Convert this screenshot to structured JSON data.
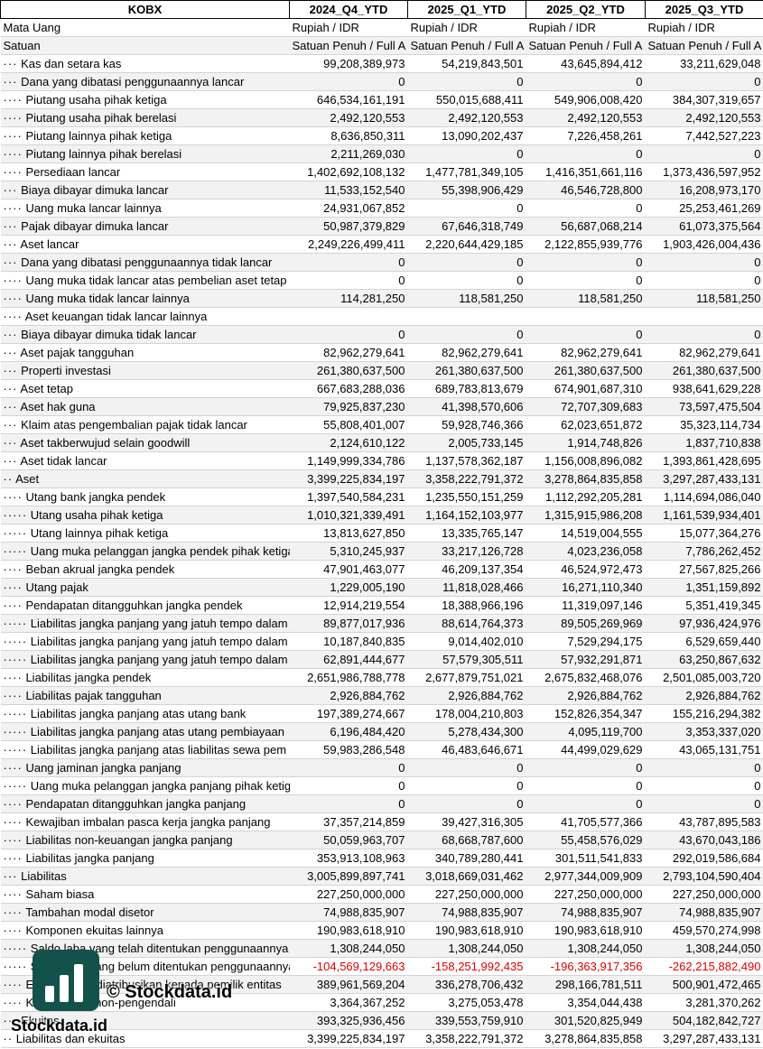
{
  "header": [
    "KOBX",
    "2024_Q4_YTD",
    "2025_Q1_YTD",
    "2025_Q2_YTD",
    "2025_Q3_YTD"
  ],
  "meta_rows": [
    {
      "label": "Mata Uang",
      "values": [
        "Rupiah / IDR",
        "Rupiah / IDR",
        "Rupiah / IDR",
        "Rupiah / IDR"
      ]
    },
    {
      "label": "Satuan",
      "values": [
        "Satuan Penuh / Full A",
        "Satuan Penuh / Full A",
        "Satuan Penuh / Full A",
        "Satuan Penuh / Full A"
      ]
    }
  ],
  "rows": [
    {
      "dots": "···",
      "label": "Kas dan setara kas",
      "values": [
        "99,208,389,973",
        "54,219,843,501",
        "43,645,894,412",
        "33,211,629,048"
      ]
    },
    {
      "dots": "···",
      "label": "Dana yang dibatasi penggunaannya lancar",
      "values": [
        "0",
        "0",
        "0",
        "0"
      ]
    },
    {
      "dots": "····",
      "label": "Piutang usaha pihak ketiga",
      "values": [
        "646,534,161,191",
        "550,015,688,411",
        "549,906,008,420",
        "384,307,319,657"
      ]
    },
    {
      "dots": "····",
      "label": "Piutang usaha pihak berelasi",
      "values": [
        "2,492,120,553",
        "2,492,120,553",
        "2,492,120,553",
        "2,492,120,553"
      ]
    },
    {
      "dots": "····",
      "label": "Piutang lainnya pihak ketiga",
      "values": [
        "8,636,850,311",
        "13,090,202,437",
        "7,226,458,261",
        "7,442,527,223"
      ]
    },
    {
      "dots": "····",
      "label": "Piutang lainnya pihak berelasi",
      "values": [
        "2,211,269,030",
        "0",
        "0",
        "0"
      ]
    },
    {
      "dots": "····",
      "label": "Persediaan lancar",
      "values": [
        "1,402,692,108,132",
        "1,477,781,349,105",
        "1,416,351,661,116",
        "1,373,436,597,952"
      ]
    },
    {
      "dots": "···",
      "label": "Biaya dibayar dimuka lancar",
      "values": [
        "11,533,152,540",
        "55,398,906,429",
        "46,546,728,800",
        "16,208,973,170"
      ]
    },
    {
      "dots": "····",
      "label": "Uang muka lancar lainnya",
      "values": [
        "24,931,067,852",
        "0",
        "0",
        "25,253,461,269"
      ]
    },
    {
      "dots": "···",
      "label": "Pajak dibayar dimuka lancar",
      "values": [
        "50,987,379,829",
        "67,646,318,749",
        "56,687,068,214",
        "61,073,375,564"
      ]
    },
    {
      "dots": "···",
      "label": "Aset lancar",
      "values": [
        "2,249,226,499,411",
        "2,220,644,429,185",
        "2,122,855,939,776",
        "1,903,426,004,436"
      ]
    },
    {
      "dots": "···",
      "label": "Dana yang dibatasi penggunaannya tidak lancar",
      "values": [
        "0",
        "0",
        "0",
        "0"
      ]
    },
    {
      "dots": "····",
      "label": "Uang muka tidak lancar atas pembelian aset tetap",
      "values": [
        "0",
        "0",
        "0",
        "0"
      ]
    },
    {
      "dots": "····",
      "label": "Uang muka tidak lancar lainnya",
      "values": [
        "114,281,250",
        "118,581,250",
        "118,581,250",
        "118,581,250"
      ]
    },
    {
      "dots": "····",
      "label": "Aset keuangan tidak lancar lainnya",
      "values": [
        "",
        "",
        "",
        ""
      ]
    },
    {
      "dots": "···",
      "label": "Biaya dibayar dimuka tidak lancar",
      "values": [
        "0",
        "0",
        "0",
        "0"
      ]
    },
    {
      "dots": "···",
      "label": "Aset pajak tangguhan",
      "values": [
        "82,962,279,641",
        "82,962,279,641",
        "82,962,279,641",
        "82,962,279,641"
      ]
    },
    {
      "dots": "···",
      "label": "Properti investasi",
      "values": [
        "261,380,637,500",
        "261,380,637,500",
        "261,380,637,500",
        "261,380,637,500"
      ]
    },
    {
      "dots": "···",
      "label": "Aset tetap",
      "values": [
        "667,683,288,036",
        "689,783,813,679",
        "674,901,687,310",
        "938,641,629,228"
      ]
    },
    {
      "dots": "···",
      "label": "Aset hak guna",
      "values": [
        "79,925,837,230",
        "41,398,570,606",
        "72,707,309,683",
        "73,597,475,504"
      ]
    },
    {
      "dots": "···",
      "label": "Klaim atas pengembalian pajak tidak lancar",
      "values": [
        "55,808,401,007",
        "59,928,746,366",
        "62,023,651,872",
        "35,323,114,734"
      ]
    },
    {
      "dots": "···",
      "label": "Aset takberwujud selain goodwill",
      "values": [
        "2,124,610,122",
        "2,005,733,145",
        "1,914,748,826",
        "1,837,710,838"
      ]
    },
    {
      "dots": "···",
      "label": "Aset tidak lancar",
      "values": [
        "1,149,999,334,786",
        "1,137,578,362,187",
        "1,156,008,896,082",
        "1,393,861,428,695"
      ]
    },
    {
      "dots": "··",
      "label": "Aset",
      "values": [
        "3,399,225,834,197",
        "3,358,222,791,372",
        "3,278,864,835,858",
        "3,297,287,433,131"
      ]
    },
    {
      "dots": "····",
      "label": "Utang bank jangka pendek",
      "values": [
        "1,397,540,584,231",
        "1,235,550,151,259",
        "1,112,292,205,281",
        "1,114,694,086,040"
      ]
    },
    {
      "dots": "·····",
      "label": "Utang usaha pihak ketiga",
      "values": [
        "1,010,321,339,491",
        "1,164,152,103,977",
        "1,315,915,986,208",
        "1,161,539,934,401"
      ]
    },
    {
      "dots": "·····",
      "label": "Utang lainnya pihak ketiga",
      "values": [
        "13,813,627,850",
        "13,335,765,147",
        "14,519,004,555",
        "15,077,364,276"
      ]
    },
    {
      "dots": "·····",
      "label": "Uang muka pelanggan jangka pendek pihak ketiga",
      "values": [
        "5,310,245,937",
        "33,217,126,728",
        "4,023,236,058",
        "7,786,262,452"
      ]
    },
    {
      "dots": "····",
      "label": "Beban akrual jangka pendek",
      "values": [
        "47,901,463,077",
        "46,209,137,354",
        "46,524,972,473",
        "27,567,825,266"
      ]
    },
    {
      "dots": "····",
      "label": "Utang pajak",
      "values": [
        "1,229,005,190",
        "11,818,028,466",
        "16,271,110,340",
        "1,351,159,892"
      ]
    },
    {
      "dots": "····",
      "label": "Pendapatan ditangguhkan jangka pendek",
      "values": [
        "12,914,219,554",
        "18,388,966,196",
        "11,319,097,146",
        "5,351,419,345"
      ]
    },
    {
      "dots": "·····",
      "label": "Liabilitas jangka panjang yang jatuh tempo dalam",
      "values": [
        "89,877,017,936",
        "88,614,764,373",
        "89,505,269,969",
        "97,936,424,976"
      ]
    },
    {
      "dots": "·····",
      "label": "Liabilitas jangka panjang yang jatuh tempo dalam",
      "values": [
        "10,187,840,835",
        "9,014,402,010",
        "7,529,294,175",
        "6,529,659,440"
      ]
    },
    {
      "dots": "·····",
      "label": "Liabilitas jangka panjang yang jatuh tempo dalam",
      "values": [
        "62,891,444,677",
        "57,579,305,511",
        "57,932,291,871",
        "63,250,867,632"
      ]
    },
    {
      "dots": "····",
      "label": "Liabilitas jangka pendek",
      "values": [
        "2,651,986,788,778",
        "2,677,879,751,021",
        "2,675,832,468,076",
        "2,501,085,003,720"
      ]
    },
    {
      "dots": "····",
      "label": "Liabilitas pajak tangguhan",
      "values": [
        "2,926,884,762",
        "2,926,884,762",
        "2,926,884,762",
        "2,926,884,762"
      ]
    },
    {
      "dots": "·····",
      "label": "Liabilitas jangka panjang atas utang bank",
      "values": [
        "197,389,274,667",
        "178,004,210,803",
        "152,826,354,347",
        "155,216,294,382"
      ]
    },
    {
      "dots": "·····",
      "label": "Liabilitas jangka panjang atas utang pembiayaan",
      "values": [
        "6,196,484,420",
        "5,278,434,300",
        "4,095,119,700",
        "3,353,337,020"
      ]
    },
    {
      "dots": "·····",
      "label": "Liabilitas jangka panjang atas liabilitas sewa pem",
      "values": [
        "59,983,286,548",
        "46,483,646,671",
        "44,499,029,629",
        "43,065,131,751"
      ]
    },
    {
      "dots": "····",
      "label": "Uang jaminan jangka panjang",
      "values": [
        "0",
        "0",
        "0",
        "0"
      ]
    },
    {
      "dots": "·····",
      "label": "Uang muka pelanggan jangka panjang pihak ketiga",
      "values": [
        "0",
        "0",
        "0",
        "0"
      ]
    },
    {
      "dots": "····",
      "label": "Pendapatan ditangguhkan jangka panjang",
      "values": [
        "0",
        "0",
        "0",
        "0"
      ]
    },
    {
      "dots": "····",
      "label": "Kewajiban imbalan pasca kerja jangka panjang",
      "values": [
        "37,357,214,859",
        "39,427,316,305",
        "41,705,577,366",
        "43,787,895,583"
      ]
    },
    {
      "dots": "····",
      "label": "Liabilitas non-keuangan jangka panjang",
      "values": [
        "50,059,963,707",
        "68,668,787,600",
        "55,458,576,029",
        "43,670,043,186"
      ]
    },
    {
      "dots": "····",
      "label": "Liabilitas jangka panjang",
      "values": [
        "353,913,108,963",
        "340,789,280,441",
        "301,511,541,833",
        "292,019,586,684"
      ]
    },
    {
      "dots": "···",
      "label": "Liabilitas",
      "values": [
        "3,005,899,897,741",
        "3,018,669,031,462",
        "2,977,344,009,909",
        "2,793,104,590,404"
      ]
    },
    {
      "dots": "····",
      "label": "Saham biasa",
      "values": [
        "227,250,000,000",
        "227,250,000,000",
        "227,250,000,000",
        "227,250,000,000"
      ]
    },
    {
      "dots": "····",
      "label": "Tambahan modal disetor",
      "values": [
        "74,988,835,907",
        "74,988,835,907",
        "74,988,835,907",
        "74,988,835,907"
      ]
    },
    {
      "dots": "····",
      "label": "Komponen ekuitas lainnya",
      "values": [
        "190,983,618,910",
        "190,983,618,910",
        "190,983,618,910",
        "459,570,274,998"
      ]
    },
    {
      "dots": "·····",
      "label": "Saldo laba yang telah ditentukan penggunaannya",
      "values": [
        "1,308,244,050",
        "1,308,244,050",
        "1,308,244,050",
        "1,308,244,050"
      ]
    },
    {
      "dots": "·····",
      "label": "Saldo laba yang belum ditentukan penggunaannya",
      "values": [
        "-104,569,129,663",
        "-158,251,992,435",
        "-196,363,917,356",
        "-262,215,882,490"
      ],
      "negative": true
    },
    {
      "dots": "····",
      "label": "Ekuitas yang diatribusikan kepada pemilik entitas",
      "values": [
        "389,961,569,204",
        "336,278,706,432",
        "298,166,781,511",
        "500,901,472,465"
      ]
    },
    {
      "dots": "····",
      "label": "Kepentingan non-pengendali",
      "values": [
        "3,364,367,252",
        "3,275,053,478",
        "3,354,044,438",
        "3,281,370,262"
      ]
    },
    {
      "dots": "···",
      "label": "Ekuitas",
      "values": [
        "393,325,936,456",
        "339,553,759,910",
        "301,520,825,949",
        "504,182,842,727"
      ]
    },
    {
      "dots": "··",
      "label": "Liabilitas dan ekuitas",
      "values": [
        "3,399,225,834,197",
        "3,358,222,791,372",
        "3,278,864,835,858",
        "3,297,287,433,131"
      ]
    }
  ],
  "watermark": {
    "copyright": "© Stockdata.id",
    "brand": "Stockdata.id",
    "logo_color": "#13524a"
  }
}
